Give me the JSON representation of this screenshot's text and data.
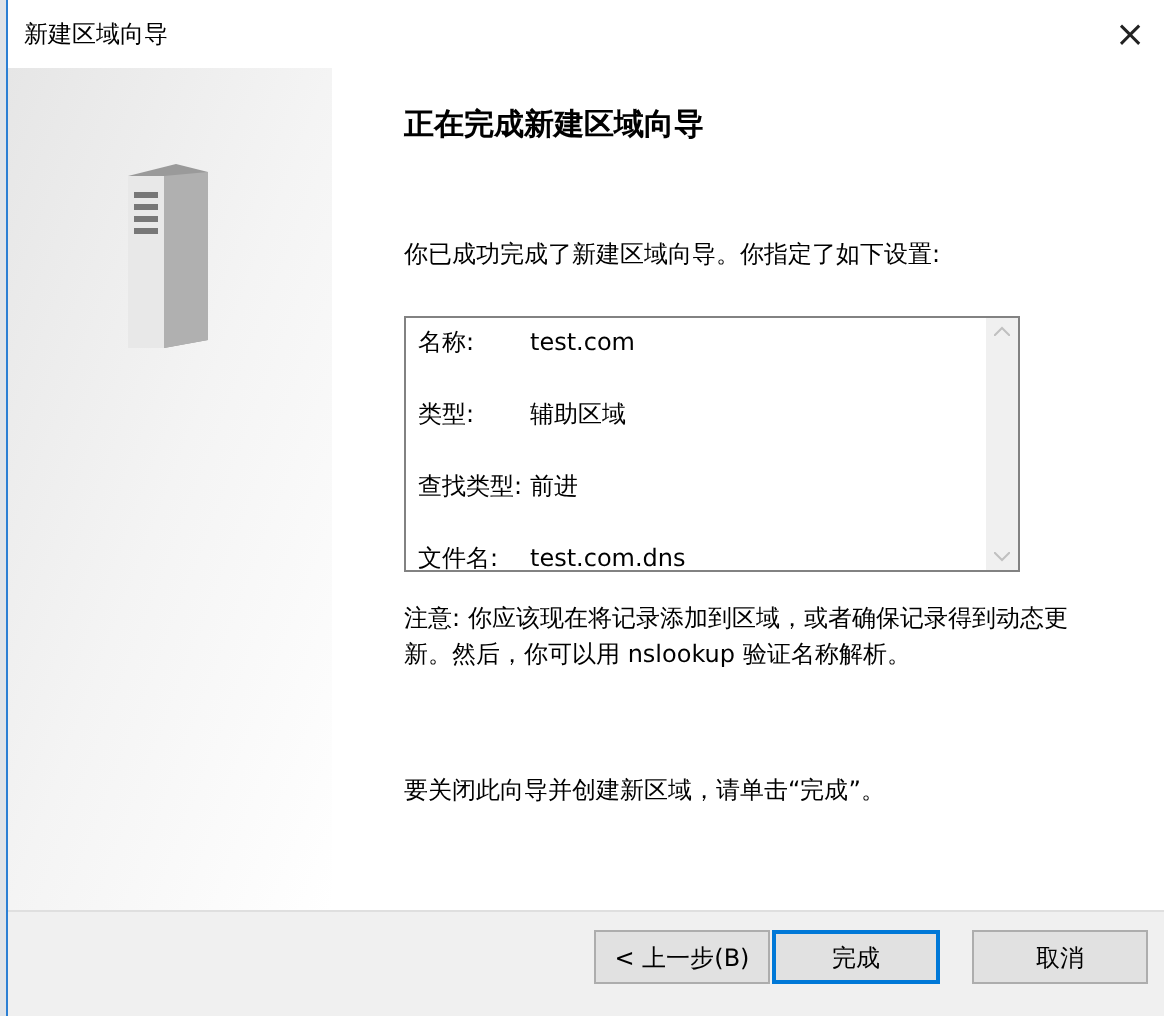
{
  "window": {
    "title": "新建区域向导",
    "close": "×"
  },
  "heading": "正在完成新建区域向导",
  "intro": "你已成功完成了新建区域向导。你指定了如下设置:",
  "settings": [
    {
      "label": "名称:",
      "value": "test.com"
    },
    {
      "label": "类型:",
      "value": "辅助区域"
    },
    {
      "label": "查找类型:",
      "value": "前进"
    },
    {
      "label": "文件名:",
      "value": "test.com.dns"
    }
  ],
  "note": "注意: 你应该现在将记录添加到区域，或者确保记录得到动态更新。然后，你可以用 nslookup 验证名称解析。",
  "closing": "要关闭此向导并创建新区域，请单击“完成”。",
  "buttons": [
    {
      "label": "< 上一步(B)",
      "default": false
    },
    {
      "label": "完成",
      "default": true
    },
    {
      "label": "取消",
      "default": false
    }
  ]
}
